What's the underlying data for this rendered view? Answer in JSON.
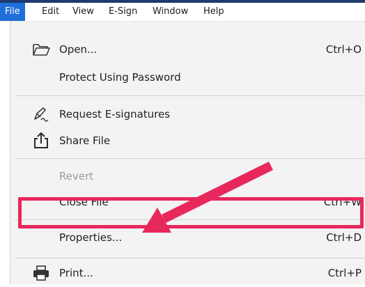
{
  "menubar": {
    "items": [
      "File",
      "Edit",
      "View",
      "E-Sign",
      "Window",
      "Help"
    ],
    "active": "File"
  },
  "file_menu": {
    "items": [
      {
        "label": "Open...",
        "shortcut": "Ctrl+O",
        "icon": "folder-open-icon"
      },
      {
        "label": "Protect Using Password"
      },
      {
        "label": "Request E-signatures",
        "icon": "pen-signature-icon"
      },
      {
        "label": "Share File",
        "icon": "share-upload-icon"
      },
      {
        "label": "Revert",
        "disabled": true
      },
      {
        "label": "Close File",
        "shortcut": "Ctrl+W"
      },
      {
        "label": "Properties...",
        "shortcut": "Ctrl+D"
      },
      {
        "label": "Print...",
        "shortcut": "Ctrl+P",
        "icon": "printer-icon"
      }
    ]
  },
  "annotation": {
    "highlighted_item": "Properties...",
    "color": "#e8285d"
  },
  "colors": {
    "menubar_active": "#1e6fd9",
    "menu_background": "#f3f3f3",
    "disabled_text": "#9a9a9a"
  }
}
